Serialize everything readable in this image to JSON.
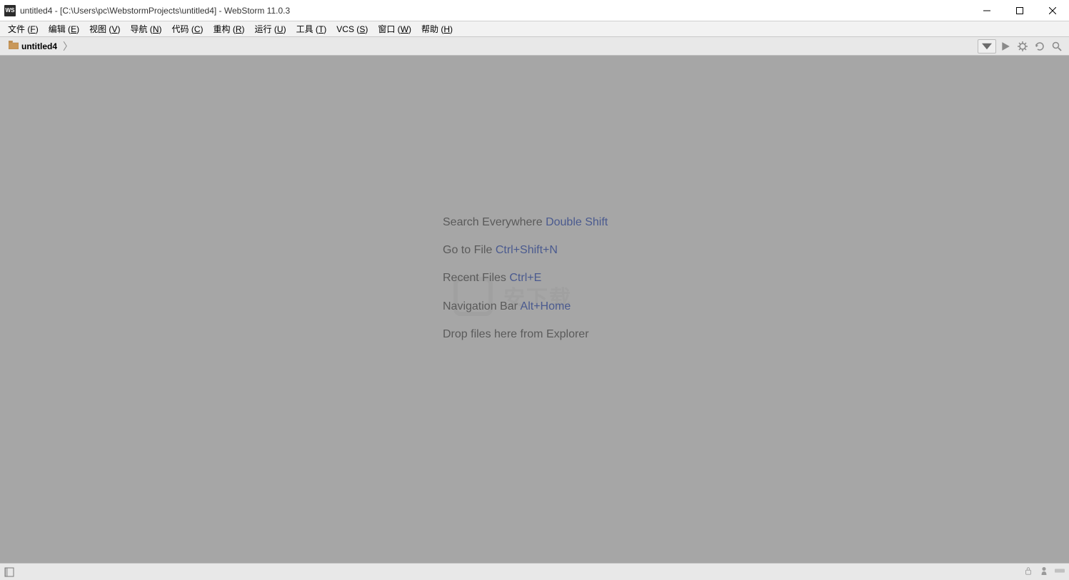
{
  "window": {
    "title": "untitled4 - [C:\\Users\\pc\\WebstormProjects\\untitled4] - WebStorm 11.0.3",
    "app_icon_text": "WS"
  },
  "menu": {
    "items": [
      {
        "label": "文件",
        "mnemonic": "F"
      },
      {
        "label": "编辑",
        "mnemonic": "E"
      },
      {
        "label": "视图",
        "mnemonic": "V"
      },
      {
        "label": "导航",
        "mnemonic": "N"
      },
      {
        "label": "代码",
        "mnemonic": "C"
      },
      {
        "label": "重构",
        "mnemonic": "R"
      },
      {
        "label": "运行",
        "mnemonic": "U"
      },
      {
        "label": "工具",
        "mnemonic": "T"
      },
      {
        "label": "VCS",
        "mnemonic": "S"
      },
      {
        "label": "窗口",
        "mnemonic": "W"
      },
      {
        "label": "帮助",
        "mnemonic": "H"
      }
    ]
  },
  "breadcrumb": {
    "project": "untitled4"
  },
  "toolbar_right": {
    "run_config_dropdown": "▾",
    "icons": [
      "run-icon",
      "debug-icon",
      "coverage-icon",
      "search-icon"
    ]
  },
  "editor_hints": [
    {
      "label": "Search Everywhere",
      "shortcut": "Double Shift"
    },
    {
      "label": "Go to File",
      "shortcut": "Ctrl+Shift+N"
    },
    {
      "label": "Recent Files",
      "shortcut": "Ctrl+E"
    },
    {
      "label": "Navigation Bar",
      "shortcut": "Alt+Home"
    },
    {
      "label": "Drop files here from Explorer",
      "shortcut": ""
    }
  ],
  "watermark": {
    "text": "安下载"
  }
}
